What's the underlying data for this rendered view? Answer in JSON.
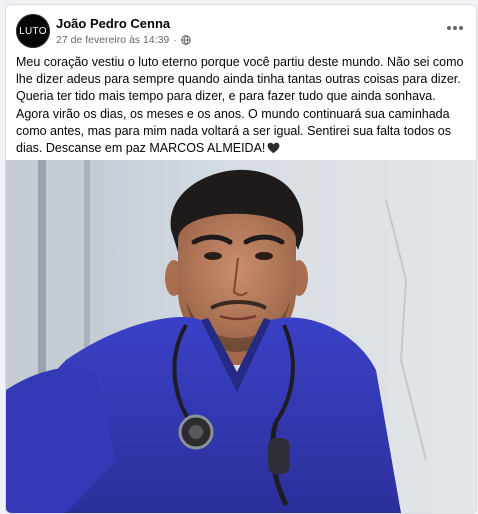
{
  "post": {
    "avatar_text": "LUTO",
    "author": "João Pedro Cenna",
    "timestamp": "27 de fevereiro às 14:39",
    "separator": "·",
    "audience_icon": "globe-icon",
    "more_icon": "more-options-icon",
    "text": "Meu coração vestiu o luto eterno porque você partiu deste mundo. Não sei como lhe dizer adeus para sempre quando ainda tinha tantas outras coisas para dizer. Queria ter tido mais tempo para dizer, e para fazer tudo que ainda sonhava. Agora virão os dias, os meses e os anos. O mundo continuará sua caminhada como antes, mas para mim nada voltará a ser igual. Sentirei sua falta todos os dias. Descanse em paz MARCOS ALMEIDA!",
    "emoji": "black-heart-icon"
  },
  "colors": {
    "page_bg": "#f0f2f5",
    "card_bg": "#ffffff",
    "primary_text": "#050505",
    "secondary_text": "#65676b",
    "scrubs_blue": "#3a3fbf"
  }
}
